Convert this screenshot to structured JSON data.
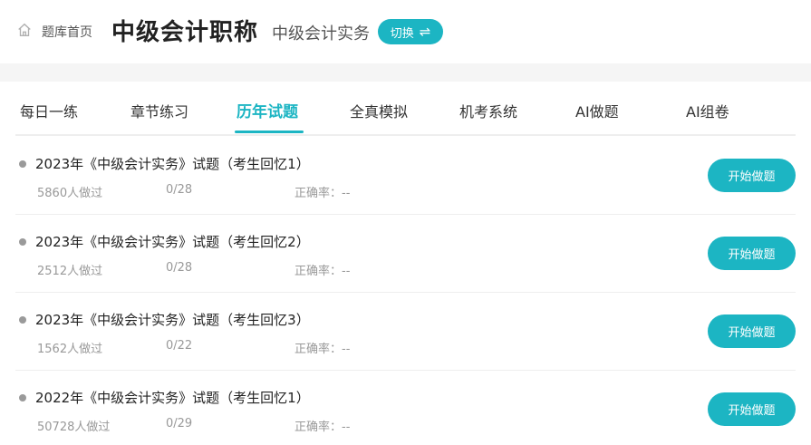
{
  "header": {
    "home_label": "题库首页",
    "title": "中级会计职称",
    "subject": "中级会计实务",
    "switch_label": "切换",
    "switch_icon": "⇌"
  },
  "tabs": [
    {
      "label": "每日一练",
      "active": false
    },
    {
      "label": "章节练习",
      "active": false
    },
    {
      "label": "历年试题",
      "active": true
    },
    {
      "label": "全真模拟",
      "active": false
    },
    {
      "label": "机考系统",
      "active": false
    },
    {
      "label": "AI做题",
      "active": false
    },
    {
      "label": "AI组卷",
      "active": false
    }
  ],
  "exams": [
    {
      "title": "2023年《中级会计实务》试题（考生回忆1）",
      "count": "5860人做过",
      "progress": "0/28",
      "accuracy": "正确率：--",
      "button": "开始做题"
    },
    {
      "title": "2023年《中级会计实务》试题（考生回忆2）",
      "count": "2512人做过",
      "progress": "0/28",
      "accuracy": "正确率：--",
      "button": "开始做题"
    },
    {
      "title": "2023年《中级会计实务》试题（考生回忆3）",
      "count": "1562人做过",
      "progress": "0/22",
      "accuracy": "正确率：--",
      "button": "开始做题"
    },
    {
      "title": "2022年《中级会计实务》试题（考生回忆1）",
      "count": "50728人做过",
      "progress": "0/29",
      "accuracy": "正确率：--",
      "button": "开始做题"
    }
  ],
  "colors": {
    "accent": "#1cb5c3",
    "band": "#f5f5f5",
    "muted": "#999999"
  },
  "icons": {
    "home": "home-icon",
    "switch": "swap-arrows-icon",
    "bullet": "bullet-dot-icon"
  }
}
